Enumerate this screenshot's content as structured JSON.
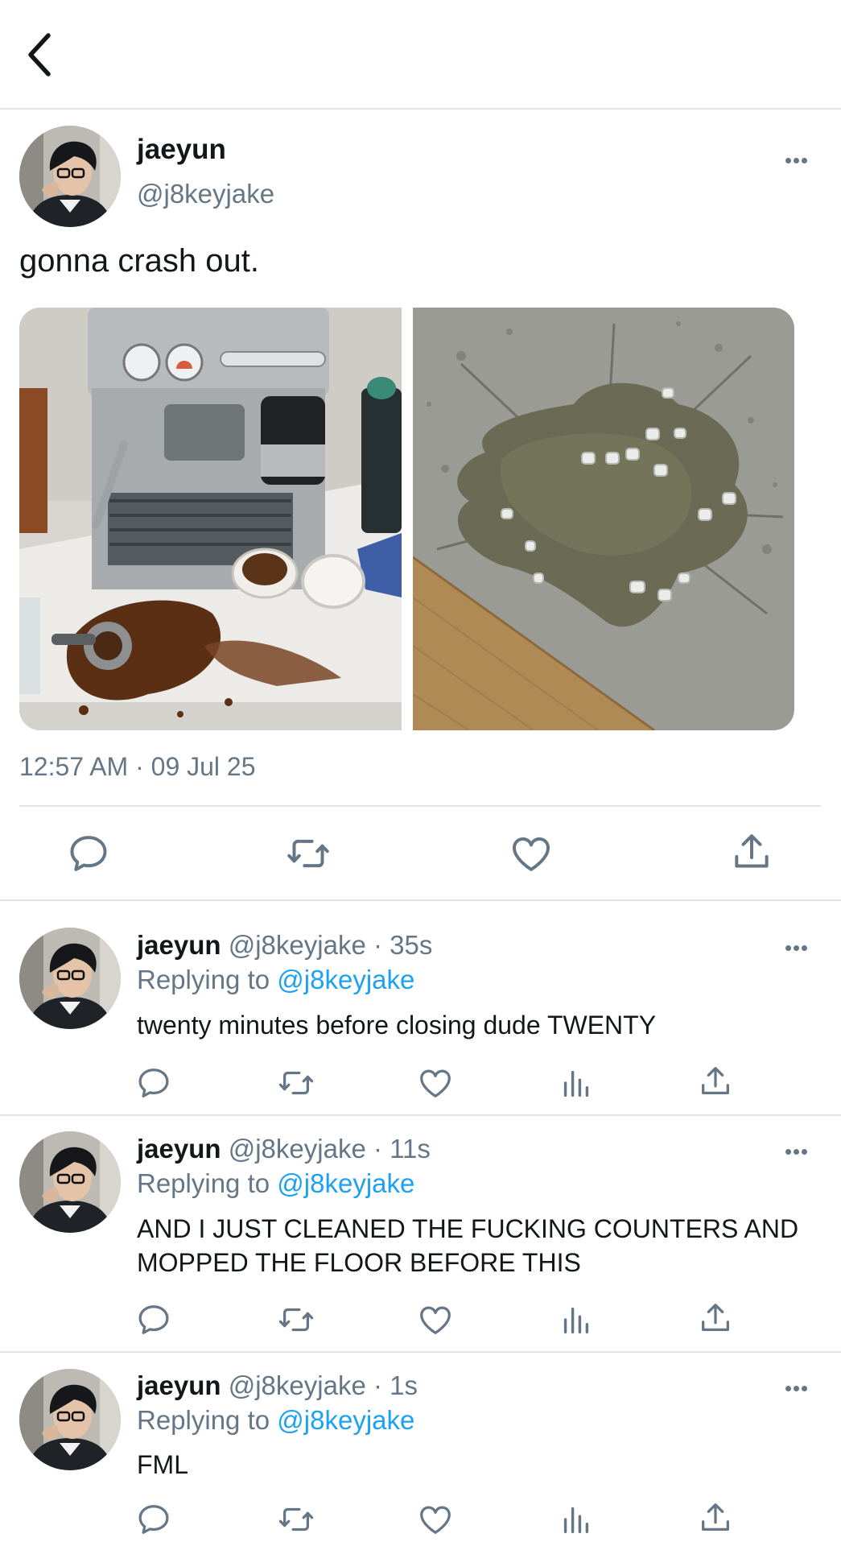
{
  "header": {
    "back_icon": "chevron-left-icon"
  },
  "tweet": {
    "author_name": "jaeyun",
    "author_handle": "@j8keyjake",
    "text": "gonna crash out.",
    "timestamp": "12:57 AM · 09 Jul 25",
    "media": [
      "espresso-machine-spill-photo",
      "spilled-iced-drink-floor-photo"
    ]
  },
  "replies": [
    {
      "name": "jaeyun",
      "handle_time": "@j8keyjake · 35s",
      "replying_label": "Replying to",
      "replying_handle": "@j8keyjake",
      "text": "twenty minutes before closing dude TWENTY"
    },
    {
      "name": "jaeyun",
      "handle_time": "@j8keyjake · 11s",
      "replying_label": "Replying to",
      "replying_handle": "@j8keyjake",
      "text": "AND I JUST CLEANED THE FUCKING COUNTERS AND MOPPED THE FLOOR BEFORE THIS"
    },
    {
      "name": "jaeyun",
      "handle_time": "@j8keyjake · 1s",
      "replying_label": "Replying to",
      "replying_handle": "@j8keyjake",
      "text": "FML"
    }
  ],
  "icons": {
    "reply": "reply-icon",
    "retweet": "retweet-icon",
    "like": "heart-icon",
    "views": "analytics-icon",
    "share": "share-icon"
  },
  "colors": {
    "link": "#1da1f2",
    "muted": "#657786",
    "text": "#14171a",
    "divider": "#e1e4e8"
  }
}
